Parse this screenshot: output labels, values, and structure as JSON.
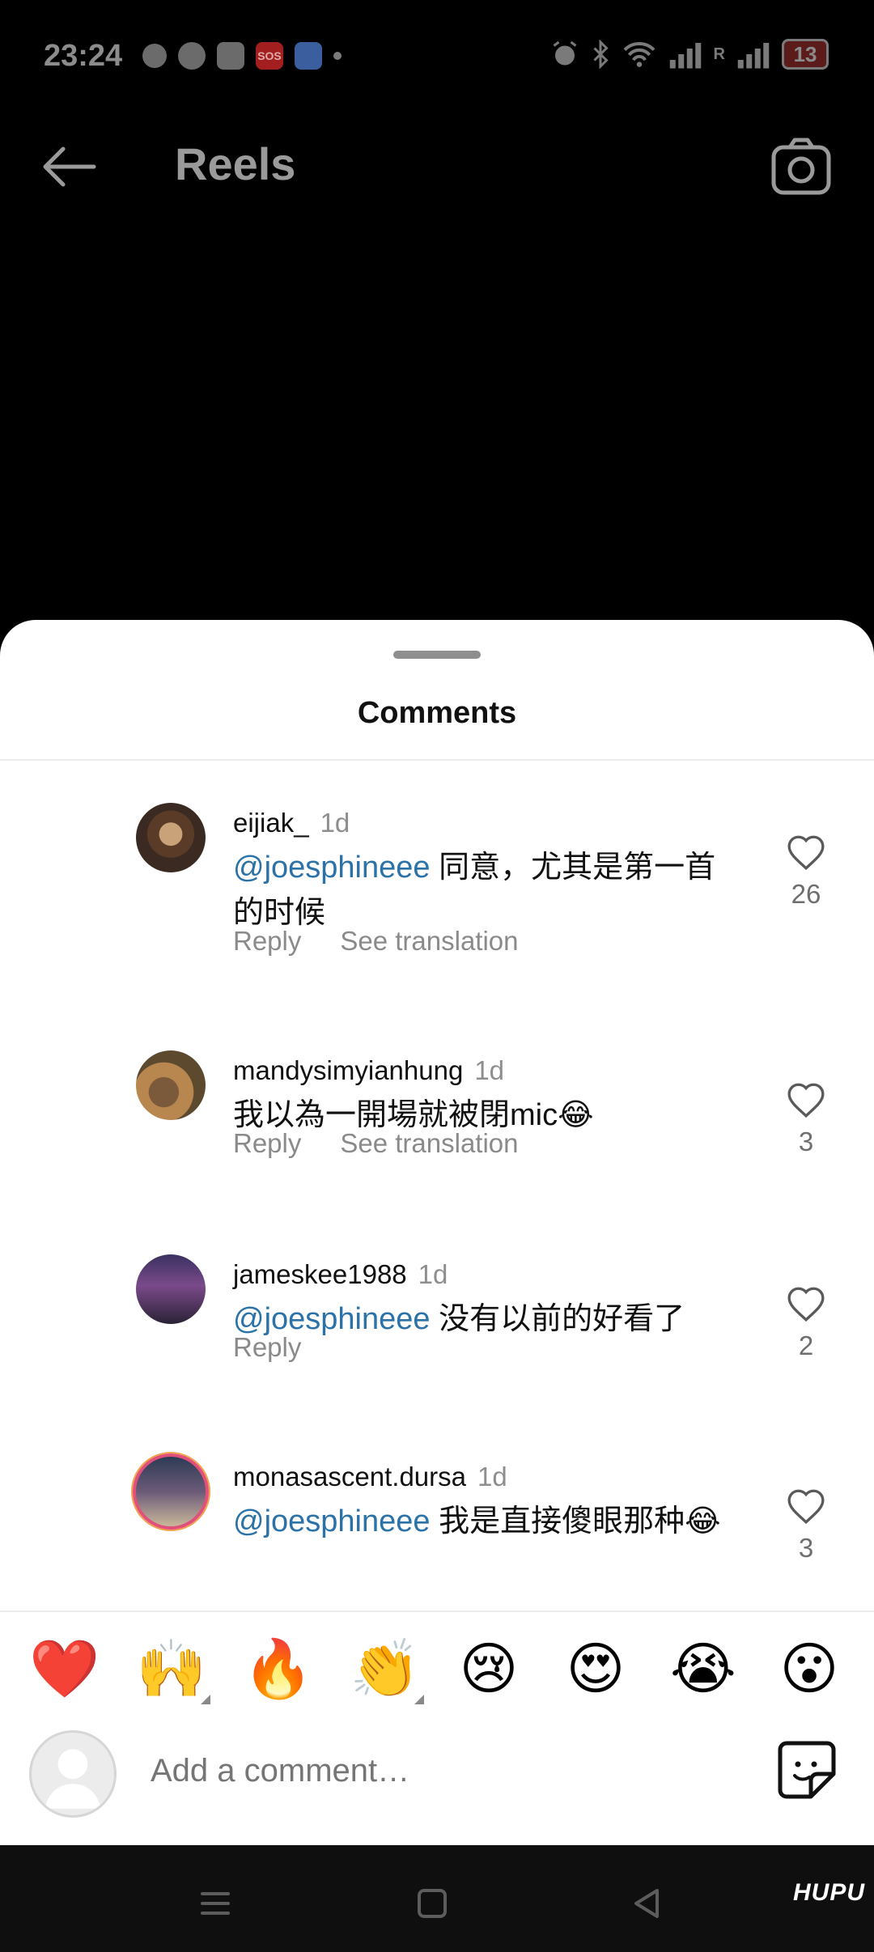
{
  "status_bar": {
    "time": "23:24",
    "sos": "SOS",
    "battery": "13",
    "signal2": "R"
  },
  "header": {
    "title": "Reels"
  },
  "sheet": {
    "title": "Comments"
  },
  "comments": [
    {
      "user": "eijiak_",
      "time": "1d",
      "mention": "@joesphineee",
      "text": " 同意，尤其是第一首的时候",
      "reply": "Reply",
      "translate": "See translation",
      "likes": "26"
    },
    {
      "user": "mandysimyianhung",
      "time": "1d",
      "mention": "",
      "text": "我以為一開場就被閉mic😂",
      "reply": "Reply",
      "translate": "See translation",
      "likes": "3"
    },
    {
      "user": "jameskee1988",
      "time": "1d",
      "mention": "@joesphineee",
      "text": " 没有以前的好看了",
      "reply": "Reply",
      "translate": "",
      "likes": "2"
    },
    {
      "user": "monasascent.dursa",
      "time": "1d",
      "mention": "@joesphineee",
      "text": " 我是直接傻眼那种😂",
      "reply": "",
      "translate": "",
      "likes": "3"
    }
  ],
  "emojis": [
    "❤️",
    "🙌",
    "🔥",
    "👏",
    "😢",
    "😍",
    "😭",
    "😮"
  ],
  "composer": {
    "placeholder": "Add a comment…"
  },
  "watermark": "HUPU",
  "colors": {
    "mention": "#2b72a8",
    "background": "#000000",
    "sheet": "#ffffff"
  }
}
